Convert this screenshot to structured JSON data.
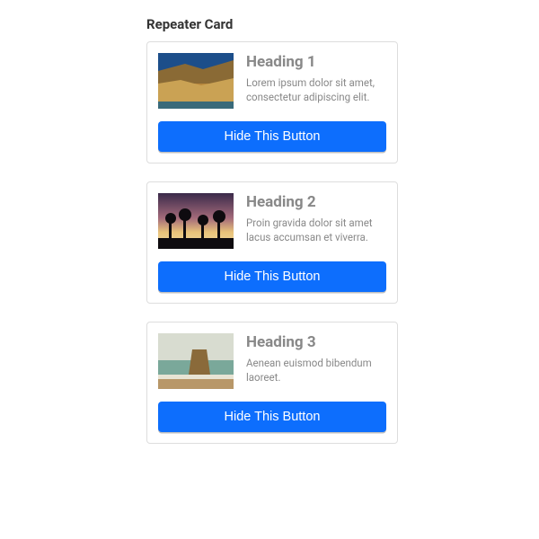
{
  "section_title": "Repeater Card",
  "cards": [
    {
      "heading": "Heading 1",
      "desc": "Lorem ipsum dolor sit amet, consectetur adipiscing elit.",
      "button_label": "Hide This Button",
      "image_name": "cliff-beach-thumbnail"
    },
    {
      "heading": "Heading 2",
      "desc": "Proin gravida dolor sit amet lacus accumsan et viverra.",
      "button_label": "Hide This Button",
      "image_name": "sunset-palms-thumbnail"
    },
    {
      "heading": "Heading 3",
      "desc": "Aenean euismod bibendum laoreet.",
      "button_label": "Hide This Button",
      "image_name": "ocean-rock-thumbnail"
    }
  ]
}
